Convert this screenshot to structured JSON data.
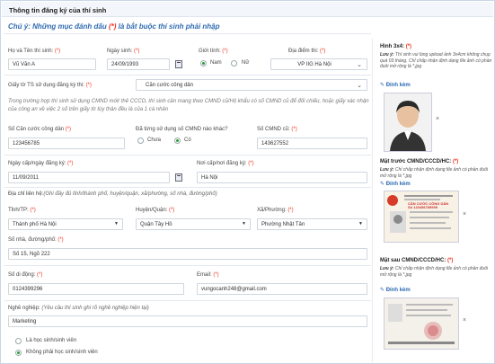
{
  "header": {
    "title": "Thông tin đăng ký của thí sinh"
  },
  "note": {
    "prefix": "Chú ý: Những mục đánh dấu ",
    "mark": "(*)",
    "suffix": " là bắt buộc thí sinh phải nhập"
  },
  "form": {
    "fullname": {
      "label": "Họ và Tên thí sinh:",
      "req": "(*)",
      "value": "Vũ Văn A"
    },
    "dob": {
      "label": "Ngày sinh:",
      "req": "(*)",
      "value": "24/09/1993"
    },
    "gender": {
      "label": "Giới tính:",
      "req": "(*)",
      "options": [
        "Nam",
        "Nữ"
      ],
      "selected": "Nam"
    },
    "venue": {
      "label": "Địa điểm thi:",
      "req": "(*)",
      "value": "VP IIG Hà Nội"
    },
    "idtype": {
      "label": "Giấy tờ TS sử dụng đăng ký thi:",
      "req": "(*)",
      "value": "Căn cước công dân"
    },
    "idnote": "Trong trường hợp thí sinh sử dụng CMND mới/ thẻ CCCD, thí sinh cần mang theo CMND cũ/Hộ khẩu có số CMND cũ để đối chiếu, hoặc giấy xác nhận của công an về việc 2 số trên giấy tờ tùy thân đều là của 1 cá nhân",
    "idnum": {
      "label": "Số Căn cước công dân",
      "req": "(*)",
      "value": "123456785"
    },
    "usedold": {
      "label": "Đã từng sử dụng số CMND nào khác?",
      "options": [
        "Chưa",
        "Có"
      ],
      "selected": "Có"
    },
    "oldid": {
      "label": "Số CMND cũ:",
      "req": "(*)",
      "value": "143627552"
    },
    "issuedate": {
      "label": "Ngày cấp/ngày đăng ký:",
      "req": "(*)",
      "value": "11/09/2011"
    },
    "issueplace": {
      "label": "Nơi cấp/nơi đăng ký:",
      "req": "(*)",
      "value": "Hà Nội"
    },
    "address": {
      "label": "Địa chỉ liên hệ:",
      "hint": "(Ghi đầy đủ tỉnh/thành phố, huyện/quận, xã/phường, số nhà, đường/phố)"
    },
    "province": {
      "label": "Tỉnh/TP:",
      "req": "(*)",
      "value": "Thành phố Hà Nội"
    },
    "district": {
      "label": "Huyện/Quận:",
      "req": "(*)",
      "value": "Quận Tây Hồ"
    },
    "ward": {
      "label": "Xã/Phường:",
      "req": "(*)",
      "value": "Phường Nhật Tân"
    },
    "street": {
      "label": "Số nhà, đường/phố:",
      "req": "(*)",
      "value": "Số 15, Ngõ 222"
    },
    "phone": {
      "label": "Số di động:",
      "req": "(*)",
      "value": "0124399296"
    },
    "email": {
      "label": "Email:",
      "req": "(*)",
      "value": "vungocanh248@gmail.com"
    },
    "job": {
      "label": "Nghề nghiệp:",
      "hint": "(Yêu cầu thí sinh ghi rõ nghề nghiệp hiện tại)",
      "value": "Marketing"
    },
    "studentopt": {
      "options": [
        "Là học sinh/sinh viên",
        "Không phải học sinh/sinh viên"
      ],
      "selected": "Không phải học sinh/sinh viên"
    }
  },
  "side": {
    "photo": {
      "title": "Hình 3x4:",
      "req": "(*)",
      "note_b": "Lưu ý:",
      "note": " Thí sinh vui lòng upload ảnh 3x4cm không chụp quá 03 tháng. Chỉ chấp nhận định dạng file ảnh có phần đuôi mở rộng là *.jpg",
      "attach": "Đính kèm"
    },
    "front": {
      "title": "Mặt trước CMND/CCCD/HC:",
      "req": "(*)",
      "note_b": "Lưu ý:",
      "note": " Chỉ chấp nhận định dạng file ảnh có phần đuôi mở rộng là *.jpg",
      "attach": "Đính kèm",
      "card_title": "CĂN CƯỚC CÔNG DÂN",
      "card_no": "Số 123456789999"
    },
    "back": {
      "title": "Mặt sau CMND/CCCD/HC:",
      "req": "(*)",
      "note_b": "Lưu ý:",
      "note": " Chỉ chấp nhận định dạng file ảnh có phần đuôi mở rộng là *.jpg",
      "attach": "Đính kèm"
    }
  },
  "colors": {
    "accent": "#2d6ab0",
    "required": "#e33322",
    "radio_on": "#2a9a3a"
  }
}
